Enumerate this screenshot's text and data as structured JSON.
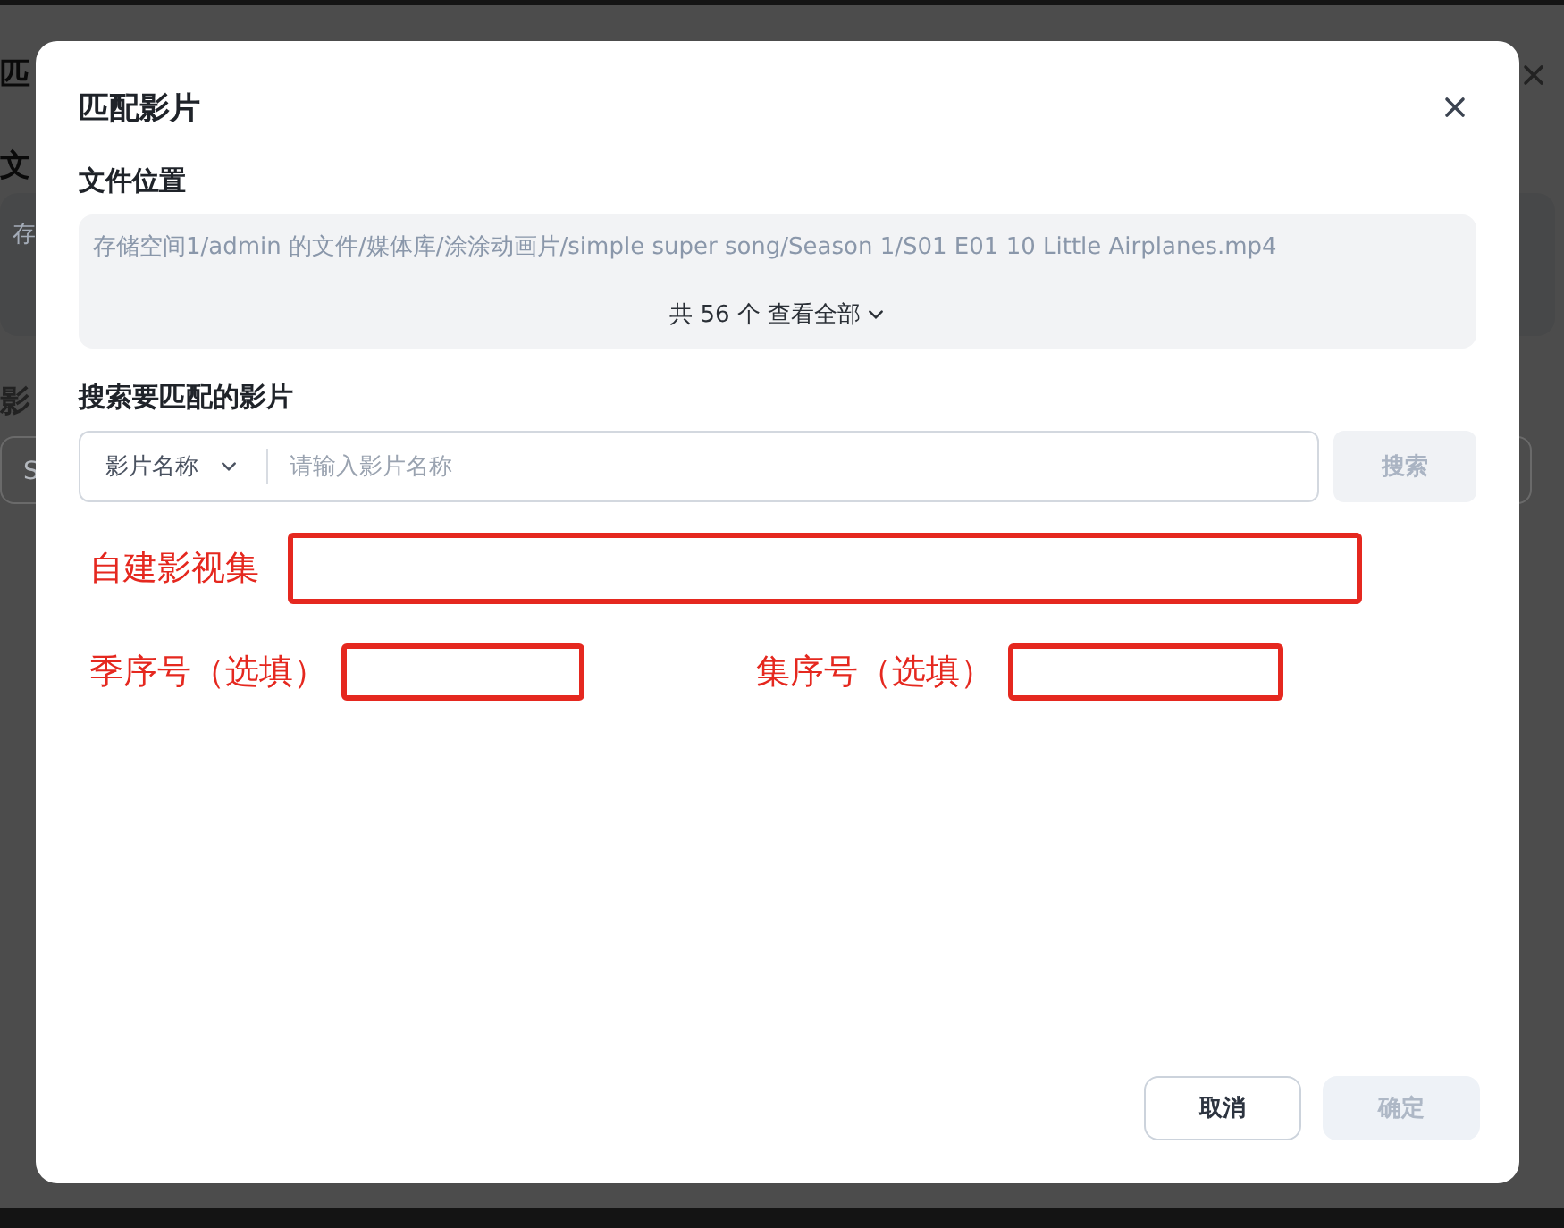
{
  "background": {
    "texts": [
      "匹",
      "文",
      "存",
      "影"
    ],
    "field_value": "S"
  },
  "dialog": {
    "title": "匹配影片",
    "file_location": {
      "label": "文件位置",
      "path": "存储空间1/admin 的文件/媒体库/涂涂动画片/simple super song/Season 1/S01 E01 10 Little Airplanes.mp4",
      "count": "共 56 个",
      "view_all": "查看全部"
    },
    "search": {
      "label": "搜索要匹配的影片",
      "type_select": "影片名称",
      "placeholder": "请输入影片名称",
      "button": "搜索",
      "button_disabled": true
    },
    "annotations": [
      {
        "label": "自建影视集",
        "kind": "wide"
      },
      {
        "label": "季序号（选填）",
        "kind": "short"
      },
      {
        "label": "集序号（选填）",
        "kind": "short"
      }
    ],
    "buttons": [
      {
        "label": "取消",
        "kind": "secondary",
        "disabled": false
      },
      {
        "label": "确定",
        "kind": "primary",
        "disabled": true
      }
    ]
  }
}
